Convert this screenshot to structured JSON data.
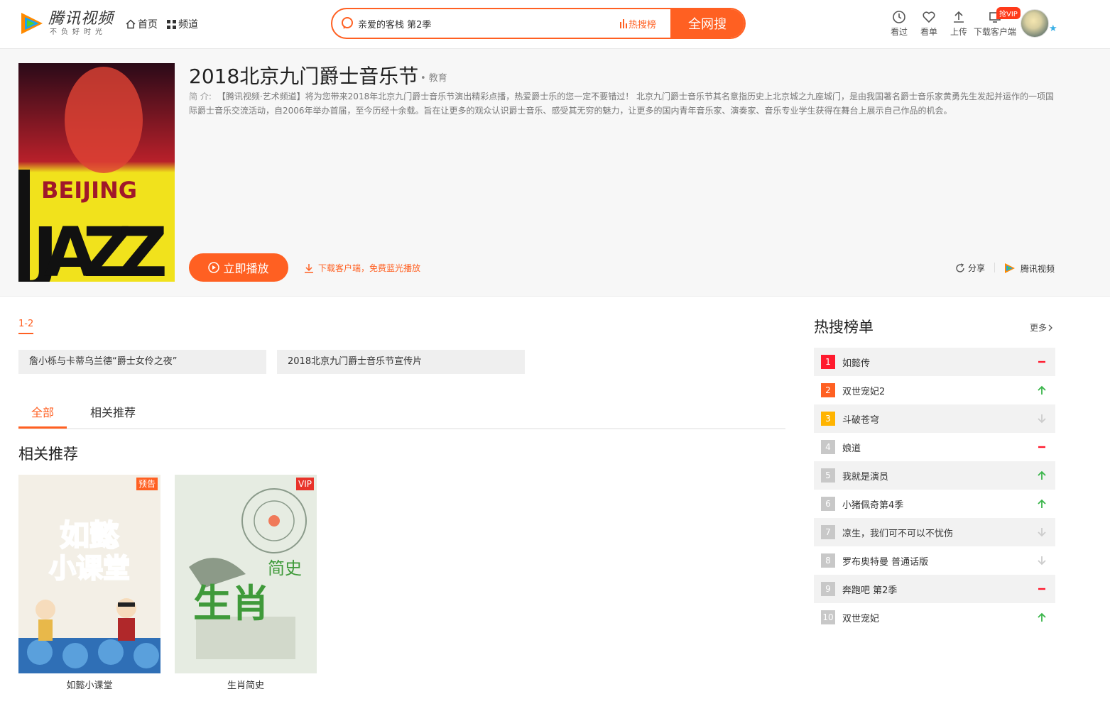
{
  "header": {
    "logo_name": "腾讯视频",
    "logo_slogan": "不负好时光",
    "nav_home": "首页",
    "nav_channel": "频道",
    "search_value": "亲爱的客栈 第2季",
    "search_hot": "热搜榜",
    "search_button": "全网搜",
    "tools": {
      "history": "看过",
      "watchlist": "看单",
      "upload": "上传",
      "client": "下载客户端"
    },
    "vip_badge": "抢VIP"
  },
  "detail": {
    "title": "2018北京九门爵士音乐节",
    "genre": "• 教育",
    "desc_label": "简  介:",
    "description": "【腾讯视频·艺术频道】将为您带来2018年北京九门爵士音乐节演出精彩点播，热爱爵士乐的您一定不要错过！ 北京九门爵士音乐节其名意指历史上北京城之九座城门，是由我国著名爵士音乐家黄勇先生发起并运作的一项国际爵士音乐交流活动，自2006年举办首届，至今历经十余载。旨在让更多的观众认识爵士音乐、感受其无穷的魅力，让更多的国内青年音乐家、演奏家、音乐专业学生获得在舞台上展示自己作品的机会。",
    "play_button": "立即播放",
    "download_text": "下载客户端，免费蓝光播放",
    "share": "分享",
    "brand": "腾讯视频",
    "poster_line1": "BEIJING",
    "poster_line2": "JAZZ"
  },
  "episodes": {
    "range": "1-2",
    "items": [
      "詹小栎与卡蒂乌兰德“爵士女伶之夜”",
      "2018北京九门爵士音乐节宣传片"
    ]
  },
  "tabs": {
    "all": "全部",
    "related": "相关推荐"
  },
  "related": {
    "title": "相关推荐",
    "cards": [
      {
        "title": "如懿小课堂",
        "badge": "预告",
        "poster_text_1": "如懿",
        "poster_text_2": "小课堂"
      },
      {
        "title": "生肖简史",
        "badge": "VIP",
        "poster_text_1": "生肖",
        "poster_text_2": "简史"
      }
    ]
  },
  "hot": {
    "title": "热搜榜单",
    "more": "更多",
    "items": [
      {
        "rank": "1",
        "name": "如懿传",
        "trend": "flat"
      },
      {
        "rank": "2",
        "name": "双世宠妃2",
        "trend": "up"
      },
      {
        "rank": "3",
        "name": "斗破苍穹",
        "trend": "down"
      },
      {
        "rank": "4",
        "name": "娘道",
        "trend": "flat"
      },
      {
        "rank": "5",
        "name": "我就是演员",
        "trend": "up"
      },
      {
        "rank": "6",
        "name": "小猪佩奇第4季",
        "trend": "up"
      },
      {
        "rank": "7",
        "name": "凉生，我们可不可以不忧伤",
        "trend": "down"
      },
      {
        "rank": "8",
        "name": "罗布奥特曼 普通话版",
        "trend": "down"
      },
      {
        "rank": "9",
        "name": "奔跑吧 第2季",
        "trend": "flat"
      },
      {
        "rank": "10",
        "name": "双世宠妃",
        "trend": "up"
      }
    ],
    "rank_colors": {
      "1": "#ff1a2e",
      "2": "#ff6022",
      "3": "#ffb400",
      "default": "#c8c8c8"
    }
  },
  "colors": {
    "accent": "#ff6022",
    "up": "#3ab54a",
    "down": "#cccccc",
    "flat": "#ff1a2e"
  }
}
